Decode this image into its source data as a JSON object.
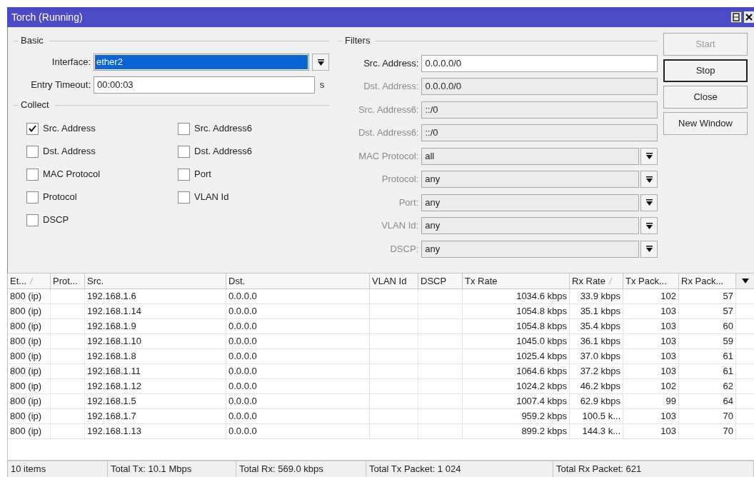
{
  "window": {
    "title": "Torch (Running)"
  },
  "basic": {
    "title": "Basic",
    "interface": {
      "label": "Interface:",
      "value": "ether2",
      "selected": true
    },
    "entry_timeout": {
      "label": "Entry Timeout:",
      "value": "00:00:03",
      "unit": "s"
    }
  },
  "collect": {
    "title": "Collect",
    "items": [
      {
        "label": "Src. Address",
        "checked": true
      },
      {
        "label": "Dst. Address",
        "checked": false
      },
      {
        "label": "MAC Protocol",
        "checked": false
      },
      {
        "label": "Protocol",
        "checked": false
      },
      {
        "label": "DSCP",
        "checked": false
      },
      {
        "label": "Src. Address6",
        "checked": false
      },
      {
        "label": "Dst. Address6",
        "checked": false
      },
      {
        "label": "Port",
        "checked": false
      },
      {
        "label": "VLAN Id",
        "checked": false
      }
    ]
  },
  "filters": {
    "title": "Filters",
    "fields": [
      {
        "label": "Src. Address:",
        "value": "0.0.0.0/0",
        "kind": "text",
        "disabled": false
      },
      {
        "label": "Dst. Address:",
        "value": "0.0.0.0/0",
        "kind": "text",
        "disabled": true
      },
      {
        "label": "Src. Address6:",
        "value": "::/0",
        "kind": "text",
        "disabled": true
      },
      {
        "label": "Dst. Address6:",
        "value": "::/0",
        "kind": "text",
        "disabled": true
      },
      {
        "label": "MAC Protocol:",
        "value": "all",
        "kind": "dropdown",
        "disabled": true
      },
      {
        "label": "Protocol:",
        "value": "any",
        "kind": "dropdown",
        "disabled": true
      },
      {
        "label": "Port:",
        "value": "any",
        "kind": "dropdown",
        "disabled": true
      },
      {
        "label": "VLAN Id:",
        "value": "any",
        "kind": "dropdown",
        "disabled": true
      },
      {
        "label": "DSCP:",
        "value": "any",
        "kind": "dropdown",
        "disabled": true
      }
    ]
  },
  "buttons": [
    {
      "label": "Start",
      "disabled": true,
      "default": false
    },
    {
      "label": "Stop",
      "disabled": false,
      "default": true
    },
    {
      "label": "Close",
      "disabled": false,
      "default": false
    },
    {
      "label": "New Window",
      "disabled": false,
      "default": false
    }
  ],
  "table": {
    "columns": [
      {
        "label": "Et...",
        "sorted": true
      },
      {
        "label": "Prot...",
        "sorted": false
      },
      {
        "label": "Src.",
        "sorted": false
      },
      {
        "label": "Dst.",
        "sorted": false
      },
      {
        "label": "VLAN Id",
        "sorted": false
      },
      {
        "label": "DSCP",
        "sorted": false
      },
      {
        "label": "Tx Rate",
        "sorted": false
      },
      {
        "label": "Rx Rate",
        "sorted": true
      },
      {
        "label": "Tx Pack...",
        "sorted": false
      },
      {
        "label": "Rx Pack...",
        "sorted": false
      }
    ],
    "rows": [
      [
        "800 (ip)",
        "",
        "192.168.1.6",
        "0.0.0.0",
        "",
        "",
        "1034.6 kbps",
        "33.9 kbps",
        "102",
        "57"
      ],
      [
        "800 (ip)",
        "",
        "192.168.1.14",
        "0.0.0.0",
        "",
        "",
        "1054.8 kbps",
        "35.1 kbps",
        "103",
        "57"
      ],
      [
        "800 (ip)",
        "",
        "192.168.1.9",
        "0.0.0.0",
        "",
        "",
        "1054.8 kbps",
        "35.4 kbps",
        "103",
        "60"
      ],
      [
        "800 (ip)",
        "",
        "192.168.1.10",
        "0.0.0.0",
        "",
        "",
        "1045.0 kbps",
        "36.1 kbps",
        "103",
        "59"
      ],
      [
        "800 (ip)",
        "",
        "192.168.1.8",
        "0.0.0.0",
        "",
        "",
        "1025.4 kbps",
        "37.0 kbps",
        "103",
        "61"
      ],
      [
        "800 (ip)",
        "",
        "192.168.1.11",
        "0.0.0.0",
        "",
        "",
        "1064.6 kbps",
        "37.2 kbps",
        "103",
        "61"
      ],
      [
        "800 (ip)",
        "",
        "192.168.1.12",
        "0.0.0.0",
        "",
        "",
        "1024.2 kbps",
        "46.2 kbps",
        "102",
        "62"
      ],
      [
        "800 (ip)",
        "",
        "192.168.1.5",
        "0.0.0.0",
        "",
        "",
        "1007.4 kbps",
        "62.9 kbps",
        "99",
        "64"
      ],
      [
        "800 (ip)",
        "",
        "192.168.1.7",
        "0.0.0.0",
        "",
        "",
        "959.2 kbps",
        "100.5 k...",
        "103",
        "70"
      ],
      [
        "800 (ip)",
        "",
        "192.168.1.13",
        "0.0.0.0",
        "",
        "",
        "899.2 kbps",
        "144.3 k...",
        "103",
        "70"
      ]
    ]
  },
  "status_bar": [
    "10 items",
    "Total Tx: 10.1 Mbps",
    "Total Rx: 569.0 kbps",
    "Total Tx Packet: 1 024",
    "Total Rx Packet: 621"
  ]
}
